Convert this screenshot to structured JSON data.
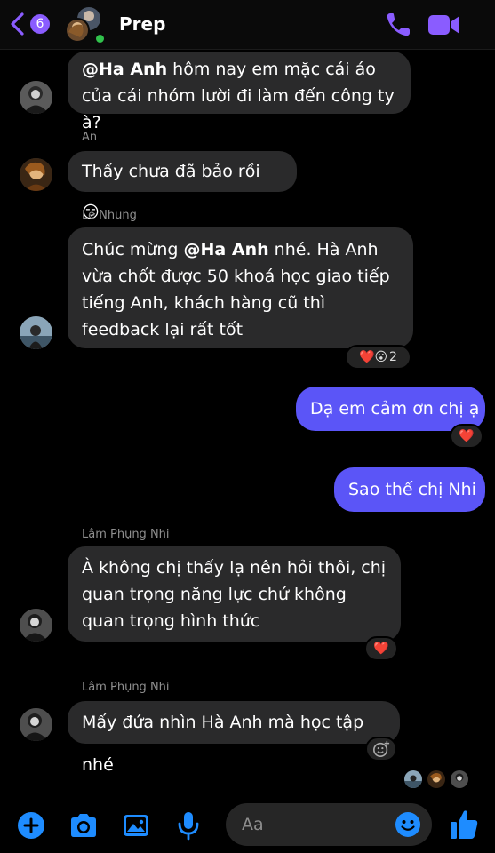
{
  "header": {
    "unread_count": "6",
    "title": "Prep",
    "icons": [
      "back-chevron-icon",
      "phone-icon",
      "video-camera-icon"
    ]
  },
  "messages": [
    {
      "sender": "",
      "text_mention": "@Ha Anh",
      "text_rest": " hôm nay em mặc cái áo của cái nhóm lười đi làm đến công ty à?"
    },
    {
      "sender": "An",
      "text": "Thấy chưa đã bảo rồi 😏"
    },
    {
      "sender": "Le Nhung",
      "text_pre": "Chúc mừng ",
      "text_mention": "@Ha Anh",
      "text_rest": " nhé. Hà Anh vừa chốt được 50 khoá học giao tiếp tiếng Anh, khách hàng cũ thì feedback lại rất tốt",
      "reaction": "❤️😮",
      "reaction_count": "2"
    },
    {
      "sender": "me",
      "text": "Dạ em cảm ơn chị ạ",
      "reaction": "❤️"
    },
    {
      "sender": "me",
      "text": "Sao thế chị Nhi"
    },
    {
      "sender": "Lâm Phụng Nhi",
      "text": "À không chị thấy lạ nên hỏi thôi, chị quan trọng năng lực chứ không quan trọng hình thức",
      "reaction": "❤️"
    },
    {
      "sender": "Lâm Phụng Nhi",
      "text": "Mấy đứa nhìn Hà Anh mà học tập nhé",
      "reaction_icon": "add-reaction-icon"
    }
  ],
  "composer": {
    "placeholder": "Aa",
    "icons": [
      "plus-icon",
      "camera-icon",
      "gallery-icon",
      "microphone-icon",
      "emoji-icon",
      "thumbs-up-icon"
    ]
  },
  "colors": {
    "accent": "#8a5cff",
    "outgoing_bubble": "#5b55f7",
    "incoming_bubble": "#2a2a2b",
    "background": "#000000",
    "tool_icon": "#1e8cff"
  }
}
